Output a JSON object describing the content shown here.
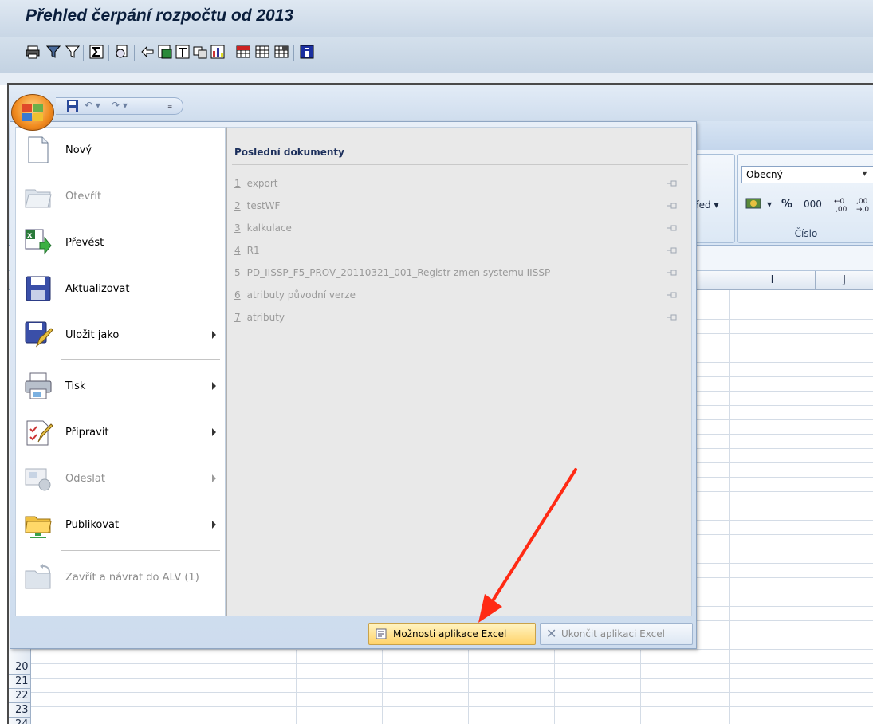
{
  "sap": {
    "title": "Přehled čerpání rozpočtu od 2013",
    "toolbar_icons": [
      "print-icon",
      "filter-icon",
      "filter-off-icon",
      "sum-icon",
      "subtotal-icon",
      "export-icon",
      "local-file-icon",
      "select-layout-icon",
      "change-layout-icon",
      "graphic-icon",
      "table-icon",
      "column-add-icon",
      "column-remove-icon",
      "info-icon"
    ]
  },
  "excel": {
    "ribbon": {
      "prev_group_label": "řed ▾",
      "number_format_value": "Obecný",
      "cislo_label": "Číslo",
      "percent_label": "%",
      "thousands_label": "000"
    },
    "columns": [
      "I",
      "J"
    ],
    "rows": [
      "20",
      "21",
      "22",
      "23",
      "24"
    ],
    "office_menu": {
      "left_items": [
        {
          "label": "Nový",
          "icon": "new-document-icon",
          "enabled": true,
          "submenu": false
        },
        {
          "label": "Otevřít",
          "icon": "open-folder-icon",
          "enabled": false,
          "submenu": false
        },
        {
          "label": "Převést",
          "icon": "convert-excel-icon",
          "enabled": true,
          "submenu": false
        },
        {
          "label": "Aktualizovat",
          "icon": "save-disk-icon",
          "enabled": true,
          "submenu": false
        },
        {
          "label": "Uložit jako",
          "icon": "save-as-icon",
          "enabled": true,
          "submenu": true
        },
        {
          "label": "Tisk",
          "icon": "printer-icon",
          "enabled": true,
          "submenu": true
        },
        {
          "label": "Připravit",
          "icon": "prepare-pencil-icon",
          "enabled": true,
          "submenu": true
        },
        {
          "label": "Odeslat",
          "icon": "send-icon",
          "enabled": false,
          "submenu": true
        },
        {
          "label": "Publikovat",
          "icon": "publish-folder-icon",
          "enabled": true,
          "submenu": true
        },
        {
          "label": "Zavřít a návrat do ALV (1)",
          "icon": "close-return-icon",
          "enabled": false,
          "submenu": false
        }
      ],
      "recent_title": "Poslední dokumenty",
      "recent_items": [
        {
          "num": "1",
          "name": "export"
        },
        {
          "num": "2",
          "name": "testWF"
        },
        {
          "num": "3",
          "name": "kalkulace"
        },
        {
          "num": "4",
          "name": "R1"
        },
        {
          "num": "5",
          "name": "PD_IISSP_F5_PROV_20110321_001_Registr zmen systemu IISSP"
        },
        {
          "num": "6",
          "name": "atributy původní verze"
        },
        {
          "num": "7",
          "name": "atributy"
        }
      ],
      "options_button": "Možnosti aplikace Excel",
      "exit_button": "Ukončit aplikaci Excel"
    }
  },
  "colors": {
    "accent_orange": "#f08a1e",
    "annotation_red": "#ff2a14",
    "menu_blue": "#1c2f5c"
  }
}
